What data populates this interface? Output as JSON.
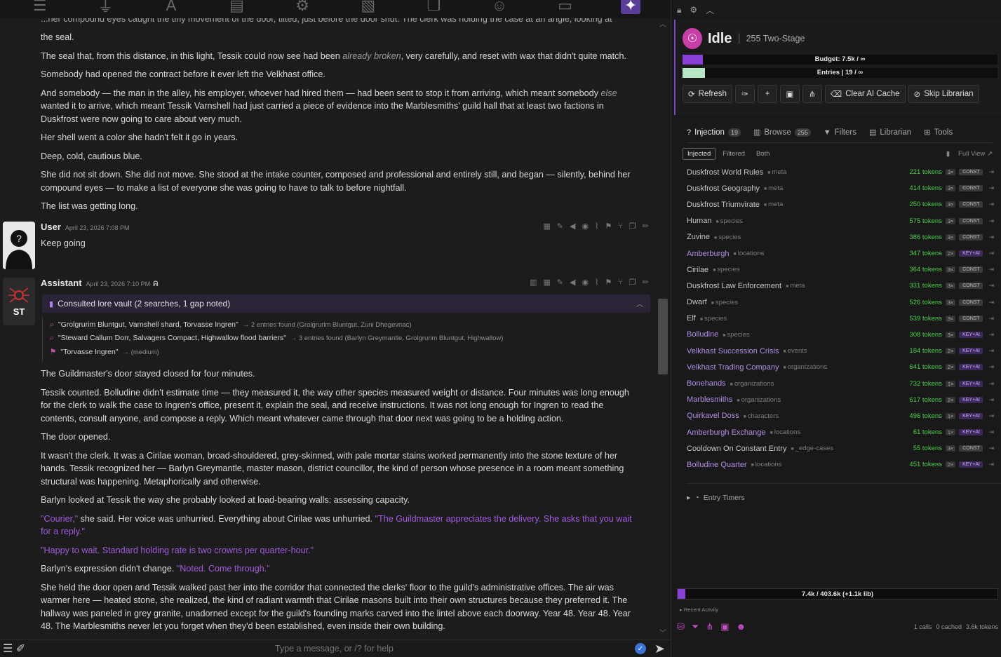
{
  "toolbar": {
    "icons": [
      "sliders-icon",
      "plug-icon",
      "font-icon",
      "book-icon",
      "user-gear-icon",
      "image-icon",
      "cubes-icon",
      "smile-icon",
      "id-card-icon",
      "wand-icon"
    ]
  },
  "chat": {
    "cut_line": "...her compound eyes caught the tiny movement of the door, tilted, just before the door shut. The clerk was holding the case at an angle, looking at",
    "prev_paragraphs": [
      "the seal.",
      "Somebody had opened the contract before it ever left the Velkhast office.",
      "Her shell went a color she hadn't felt it go in years.",
      "Deep, cold, cautious blue.",
      "She did not sit down. She did not move. She stood at the intake counter, composed and professional and entirely still, and began — silently, behind her compound eyes — to make a list of everyone she was going to have to talk to before nightfall.",
      "The list was getting long."
    ],
    "seal_para": {
      "before": "The seal that, from this distance, in this light, Tessik could now see had been ",
      "em": "already broken",
      "after": ", very carefully, and reset with wax that didn't quite match."
    },
    "somebody_para": {
      "before": "And somebody — the man in the alley, his employer, whoever had hired them — had been sent to stop it from arriving, which meant somebody ",
      "em": "else",
      "after": " wanted it to arrive, which meant Tessik Varnshell had just carried a piece of evidence into the Marblesmiths' guild hall that at least two factions in Duskfrost were now going to care about very much."
    },
    "user_msg": {
      "name": "User",
      "time": "April 23, 2026 7:08 PM",
      "text": "Keep going"
    },
    "assistant_msg": {
      "name": "Assistant",
      "time": "April 23, 2026 7:10 PM",
      "avatar_text": "ST",
      "lore_title": "Consulted lore vault (2 searches, 1 gap noted)",
      "lore_rows": [
        {
          "icon": "search-icon",
          "query": "\"Grolgrurim Bluntgut, Varnshell shard, Torvasse Ingren\"",
          "result": "→ 2 entries found (Grolgrurim Bluntgut, Zuni Dhegevnac)"
        },
        {
          "icon": "search-icon",
          "query": "\"Steward Callum Dorr, Salvagers Compact, Highwallow flood barriers\"",
          "result": "→ 3 entries found (Barlyn Greymantle, Grolgrurim Bluntgut, Highwallow)"
        },
        {
          "icon": "flag-icon",
          "query": "\"Torvasse Ingren\"",
          "result": "→ (medium)"
        }
      ],
      "p1": "The Guildmaster's door stayed closed for four minutes.",
      "p2": "Tessik counted. Bolludine didn't estimate time — they measured it, the way other species measured weight or distance. Four minutes was long enough for the clerk to walk the case to Ingren's office, present it, explain the seal, and receive instructions. It was not long enough for Ingren to read the contents, consult anyone, and compose a reply. Which meant whatever came through that door next was going to be a holding action.",
      "p3": "The door opened.",
      "p4": "It wasn't the clerk. It was a Cirilae woman, broad-shouldered, grey-skinned, with pale mortar stains worked permanently into the stone texture of her hands. Tessik recognized her — Barlyn Greymantle, master mason, district councillor, the kind of person whose presence in a room meant something structural was happening. Metaphorically and otherwise.",
      "p5": "Barlyn looked at Tessik the way she probably looked at load-bearing walls: assessing capacity.",
      "p6_q1": "\"Courier,\"",
      "p6_mid": " she said. Her voice was unhurried. Everything about Cirilae was unhurried. ",
      "p6_q2": "\"The Guildmaster appreciates the delivery. She asks that you wait for a reply.\"",
      "p7": "\"Happy to wait. Standard holding rate is two crowns per quarter-hour.\"",
      "p8_a": "Barlyn's expression didn't change. ",
      "p8_q": "\"Noted. Come through.\"",
      "p9": "She held the door open and Tessik walked past her into the corridor that connected the clerks' floor to the guild's administrative offices. The air was warmer here — heated stone, she realized, the kind of radiant warmth that Cirilae masons built into their own structures because they preferred it. The hallway was paneled in grey granite, unadorned except for the guild's founding marks carved into the lintel above each doorway. Year 48. Year 48. Year 48. The Marblesmiths never let you forget when they'd been established, even inside their own building."
    },
    "input_placeholder": "Type a message, or /? for help"
  },
  "panel": {
    "status": "Idle",
    "sub": "255  Two-Stage",
    "budget_label": "Budget: 7.5k / ∞",
    "budget_fill": 0.064,
    "entries_label": "Entries | 19 / ∞",
    "entries_fill": 0.072,
    "buttons": {
      "refresh": "Refresh",
      "clear_cache": "Clear AI Cache",
      "skip": "Skip Librarian"
    },
    "tabs": [
      {
        "label": "Injection",
        "badge": "19"
      },
      {
        "label": "Browse",
        "badge": "255"
      },
      {
        "label": "Filters",
        "badge": ""
      },
      {
        "label": "Librarian",
        "badge": ""
      },
      {
        "label": "Tools",
        "badge": ""
      }
    ],
    "subtabs": [
      "Injected",
      "Filtered",
      "Both"
    ],
    "full_view": "Full View",
    "entries": [
      {
        "name": "Duskfrost World Rules",
        "cat": "meta",
        "tokens": "221 tokens",
        "mult": "3×",
        "tag": "CONST",
        "key": false
      },
      {
        "name": "Duskfrost Geography",
        "cat": "meta",
        "tokens": "414 tokens",
        "mult": "3×",
        "tag": "CONST",
        "key": false
      },
      {
        "name": "Duskfrost Triumvirate",
        "cat": "meta",
        "tokens": "250 tokens",
        "mult": "3×",
        "tag": "CONST",
        "key": false
      },
      {
        "name": "Human",
        "cat": "species",
        "tokens": "575 tokens",
        "mult": "3×",
        "tag": "CONST",
        "key": false
      },
      {
        "name": "Zuvine",
        "cat": "species",
        "tokens": "386 tokens",
        "mult": "3×",
        "tag": "CONST",
        "key": false
      },
      {
        "name": "Amberburgh",
        "cat": "locations",
        "tokens": "347 tokens",
        "mult": "2×",
        "tag": "KEY+AI",
        "key": true
      },
      {
        "name": "Cirilae",
        "cat": "species",
        "tokens": "364 tokens",
        "mult": "3×",
        "tag": "CONST",
        "key": false
      },
      {
        "name": "Duskfrost Law Enforcement",
        "cat": "meta",
        "tokens": "331 tokens",
        "mult": "3×",
        "tag": "CONST",
        "key": false
      },
      {
        "name": "Dwarf",
        "cat": "species",
        "tokens": "526 tokens",
        "mult": "3×",
        "tag": "CONST",
        "key": false
      },
      {
        "name": "Elf",
        "cat": "species",
        "tokens": "539 tokens",
        "mult": "3×",
        "tag": "CONST",
        "key": false
      },
      {
        "name": "Bolludine",
        "cat": "species",
        "tokens": "308 tokens",
        "mult": "3×",
        "tag": "KEY+AI",
        "key": true
      },
      {
        "name": "Velkhast Succession Crisis",
        "cat": "events",
        "tokens": "184 tokens",
        "mult": "2×",
        "tag": "KEY+AI",
        "key": true
      },
      {
        "name": "Velkhast Trading Company",
        "cat": "organizations",
        "tokens": "641 tokens",
        "mult": "2×",
        "tag": "KEY+AI",
        "key": true
      },
      {
        "name": "Bonehands",
        "cat": "organizations",
        "tokens": "732 tokens",
        "mult": "1×",
        "tag": "KEY+AI",
        "key": true
      },
      {
        "name": "Marblesmiths",
        "cat": "organizations",
        "tokens": "617 tokens",
        "mult": "2×",
        "tag": "KEY+AI",
        "key": true
      },
      {
        "name": "Quirkavel Doss",
        "cat": "characters",
        "tokens": "496 tokens",
        "mult": "1×",
        "tag": "KEY+AI",
        "key": true
      },
      {
        "name": "Amberburgh Exchange",
        "cat": "locations",
        "tokens": "61 tokens",
        "mult": "1×",
        "tag": "KEY+AI",
        "key": true
      },
      {
        "name": "Cooldown On Constant Entry",
        "cat": "_edge-cases",
        "tokens": "55 tokens",
        "mult": "3×",
        "tag": "CONST",
        "key": false
      },
      {
        "name": "Bolludine Quarter",
        "cat": "locations",
        "tokens": "451 tokens",
        "mult": "2×",
        "tag": "KEY+AI",
        "key": true
      }
    ],
    "timers_label": "Entry Timers",
    "footer_bar": "7.4k / 403.6k (+1.1k lib)",
    "footer_fill": 0.025,
    "recent_label": "Recent Activity",
    "stats": {
      "calls": "1 calls",
      "cached": "0 cached",
      "tokens": "3.6k tokens"
    }
  }
}
